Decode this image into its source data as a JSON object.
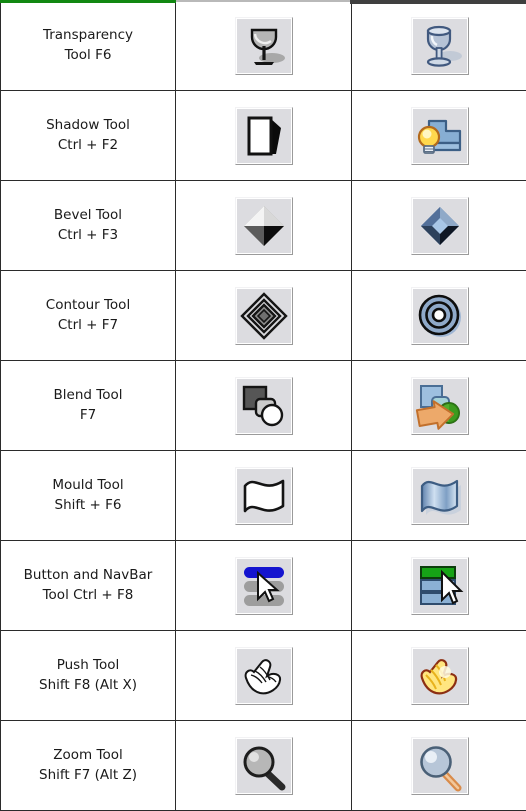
{
  "table": {
    "columns": [
      "tool-name-and-shortcut",
      "icon-grayscale",
      "icon-color"
    ],
    "top_accents": {
      "left_color": "#118811",
      "middle_color": "#b9b9b9",
      "right_color": "#3f3f3f"
    },
    "rows": [
      {
        "name_line1": "Transparency",
        "name_line2": "Tool F6",
        "tool": "Transparency Tool",
        "shortcut": "F6",
        "icon_mono": "wine-glass-gray-icon",
        "icon_color": "wine-glass-blue-icon"
      },
      {
        "name_line1": "Shadow Tool",
        "name_line2": "Ctrl + F2",
        "tool": "Shadow Tool",
        "shortcut": "Ctrl + F2",
        "icon_mono": "rectangle-with-shadow-icon",
        "icon_color": "lightbulb-with-shape-icon"
      },
      {
        "name_line1": "Bevel Tool",
        "name_line2": "Ctrl + F3",
        "tool": "Bevel Tool",
        "shortcut": "Ctrl + F3",
        "icon_mono": "beveled-diamond-gray-icon",
        "icon_color": "beveled-diamond-blue-icon"
      },
      {
        "name_line1": "Contour Tool",
        "name_line2": "Ctrl + F7",
        "tool": "Contour Tool",
        "shortcut": "Ctrl + F7",
        "icon_mono": "concentric-diamonds-icon",
        "icon_color": "concentric-circles-icon"
      },
      {
        "name_line1": "Blend Tool",
        "name_line2": "F7",
        "tool": "Blend Tool",
        "shortcut": "F7",
        "icon_mono": "square-roundrect-circle-icon",
        "icon_color": "shapes-with-arrow-icon"
      },
      {
        "name_line1": "Mould Tool",
        "name_line2": "Shift + F6",
        "tool": "Mould Tool",
        "shortcut": "Shift + F6",
        "icon_mono": "wavy-sheet-outline-icon",
        "icon_color": "wavy-sheet-blue-icon"
      },
      {
        "name_line1": "Button and NavBar",
        "name_line2": "Tool Ctrl + F8",
        "tool": "Button and NavBar Tool",
        "shortcut": "Ctrl + F8",
        "icon_mono": "navbar-buttons-cursor-icon",
        "icon_color": "navbar-bars-cursor-color-icon"
      },
      {
        "name_line1": "Push Tool",
        "name_line2": "Shift F8 (Alt X)",
        "tool": "Push Tool",
        "shortcut": "Shift F8 (Alt X)",
        "icon_mono": "hand-outline-icon",
        "icon_color": "hand-yellow-icon"
      },
      {
        "name_line1": "Zoom Tool",
        "name_line2": "Shift F7 (Alt Z)",
        "tool": "Zoom Tool",
        "shortcut": "Shift F7 (Alt Z)",
        "icon_mono": "magnifier-gray-icon",
        "icon_color": "magnifier-blue-icon"
      }
    ]
  }
}
